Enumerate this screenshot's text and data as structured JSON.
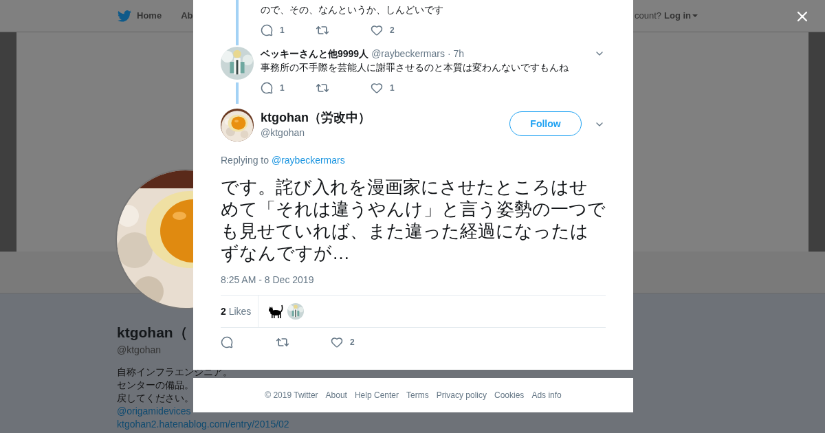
{
  "header": {
    "nav": [
      "Home",
      "Ab"
    ],
    "account_prompt": "count?",
    "login": "Log in"
  },
  "profile": {
    "name": "ktgohan（",
    "handle": "@ktgohan",
    "bio": [
      [
        {
          "kind": "text",
          "text": "自称インフラエンジニア。"
        }
      ],
      [
        {
          "kind": "text",
          "text": "センターの備品。"
        }
      ],
      [
        {
          "kind": "text",
          "text": "戻してください。"
        }
      ],
      [
        {
          "kind": "link",
          "text": "@origamidevices"
        }
      ],
      [
        {
          "kind": "link",
          "text": "ktgohan2.hatenablog.com/entry/2015/02"
        }
      ]
    ]
  },
  "thread": [
    {
      "text": "ので、その、なんというか、しんどいです",
      "replies": "1",
      "likes": "2"
    },
    {
      "name": "ベッキーさんと他9999人",
      "handle": "@raybeckermars",
      "time": "· 7h",
      "text": "事務所の不手際を芸能人に謝罪させるのと本質は変わんないですもんね",
      "replies": "1",
      "likes": "1"
    }
  ],
  "tweet": {
    "name": "ktgohan（労改中）",
    "handle": "@ktgohan",
    "follow": "Follow",
    "replying_prefix": "Replying to",
    "replying_to": "@raybeckermars",
    "text": "です。詫び入れを漫画家にさせたところはせめて「それは違うやんけ」と言う姿勢の一つでも見せていれば、また違った経過になったはずなんですが…",
    "timestamp": "8:25 AM - 8 Dec 2019",
    "likes_count": "2",
    "likes_label": "Likes",
    "likers": [
      {
        "kind": "cat"
      },
      {
        "kind": "picture"
      }
    ],
    "likes": "2"
  },
  "footer": [
    "© 2019 Twitter",
    "About",
    "Help Center",
    "Terms",
    "Privacy policy",
    "Cookies",
    "Ads info"
  ]
}
